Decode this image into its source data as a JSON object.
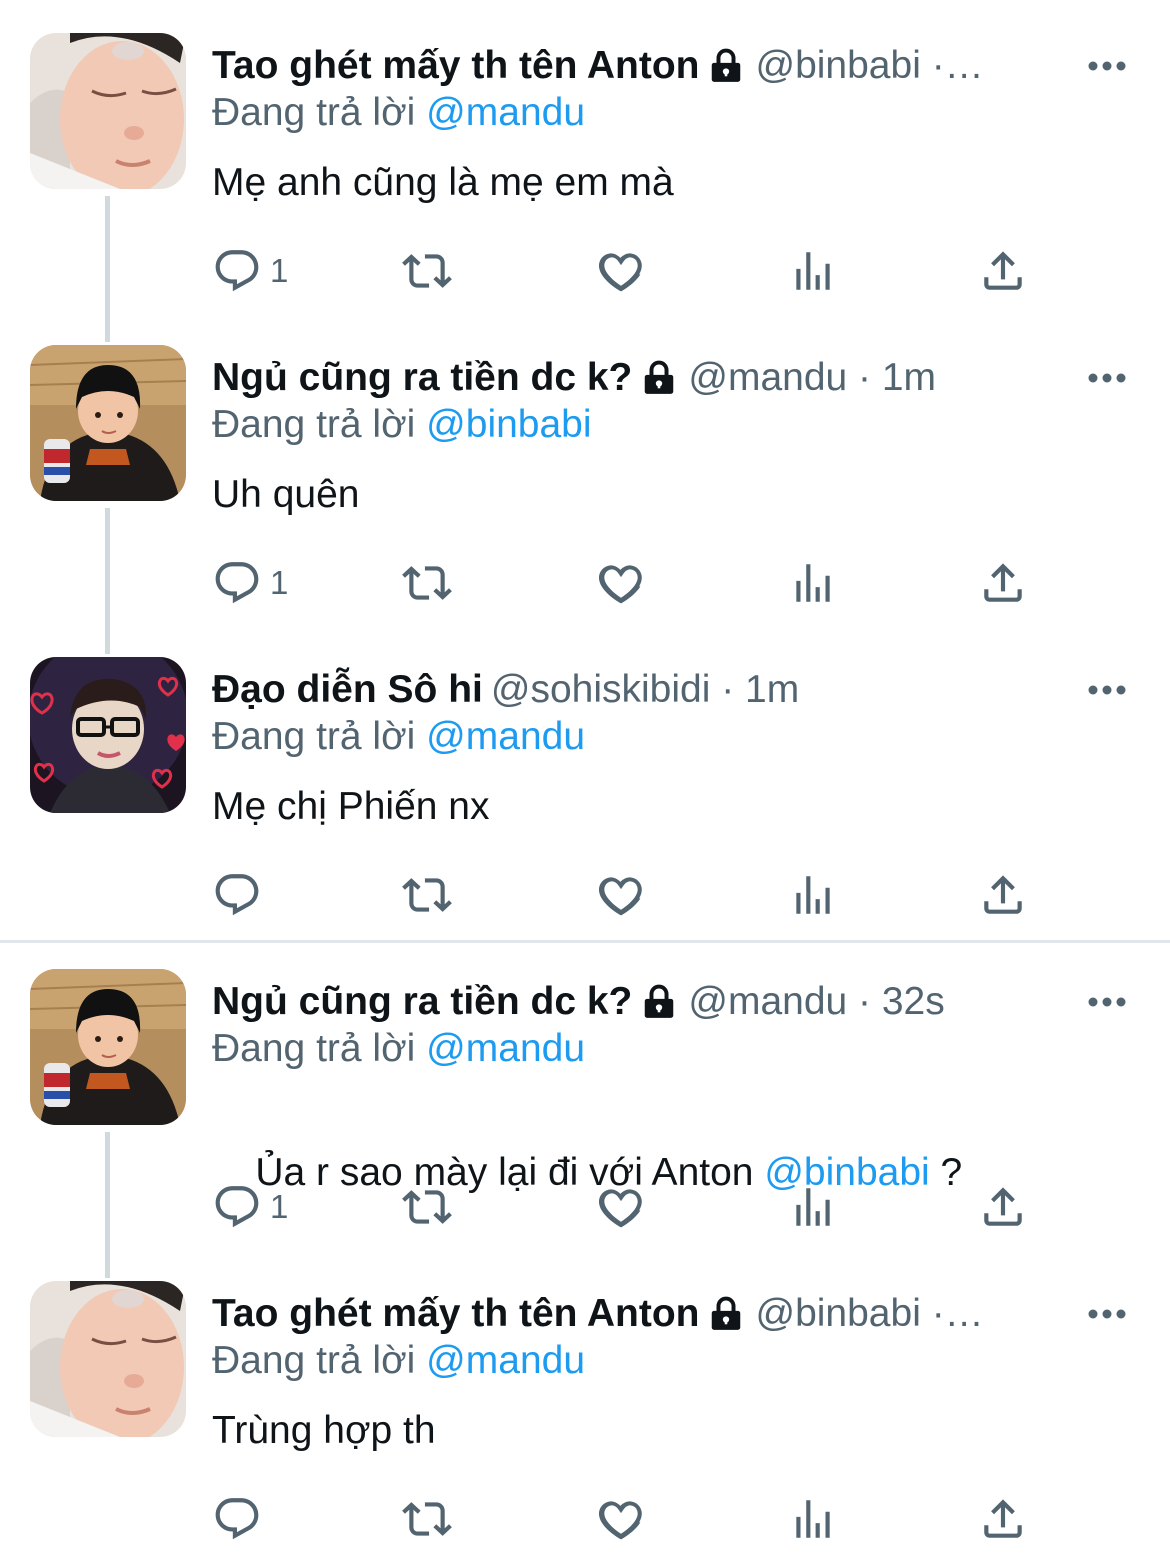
{
  "colors": {
    "accent": "#1d9bf0",
    "muted": "#536471",
    "text": "#0f1419",
    "thread_line": "#cfd9de"
  },
  "tweets": [
    {
      "name": "Tao ghét mấy th tên Anton",
      "locked": true,
      "meta": "@binbabi ·…",
      "reply_prefix": "Đang trả lời",
      "reply_to": "@mandu",
      "text": "Mẹ anh cũng là mẹ em mà",
      "text_mention": "",
      "text_suffix": "",
      "reply_count": "1",
      "avatar": "sleeping-child"
    },
    {
      "name": "Ngủ cũng ra tiền dc k?",
      "locked": true,
      "meta": "@mandu · 1m",
      "reply_prefix": "Đang trả lời",
      "reply_to": "@binbabi",
      "text": "Uh quên",
      "text_mention": "",
      "text_suffix": "",
      "reply_count": "1",
      "avatar": "child-with-can"
    },
    {
      "name": "Đạo diễn Sô hi",
      "locked": false,
      "meta": "@sohiskibidi · 1m",
      "reply_prefix": "Đang trả lời",
      "reply_to": "@mandu",
      "text": "Mẹ chị Phiến nx",
      "text_mention": "",
      "text_suffix": "",
      "reply_count": "",
      "avatar": "person-with-glasses-hearts"
    },
    {
      "name": "Ngủ cũng ra tiền dc k?",
      "locked": true,
      "meta": "@mandu · 32s",
      "reply_prefix": "Đang trả lời",
      "reply_to": "@mandu",
      "text": "Ủa r sao mày lại đi với Anton ",
      "text_mention": "@binbabi",
      "text_suffix": " ?",
      "reply_count": "1",
      "avatar": "child-with-can"
    },
    {
      "name": "Tao ghét mấy th tên Anton",
      "locked": true,
      "meta": "@binbabi ·…",
      "reply_prefix": "Đang trả lời",
      "reply_to": "@mandu",
      "text": "Trùng hợp th",
      "text_mention": "",
      "text_suffix": "",
      "reply_count": "",
      "avatar": "sleeping-child"
    }
  ],
  "icons": {
    "reply": "reply-bubble-icon",
    "retweet": "retweet-icon",
    "like": "heart-icon",
    "views": "views-bar-icon",
    "share": "share-upload-icon",
    "more": "more-dots-icon",
    "lock": "lock-icon"
  }
}
